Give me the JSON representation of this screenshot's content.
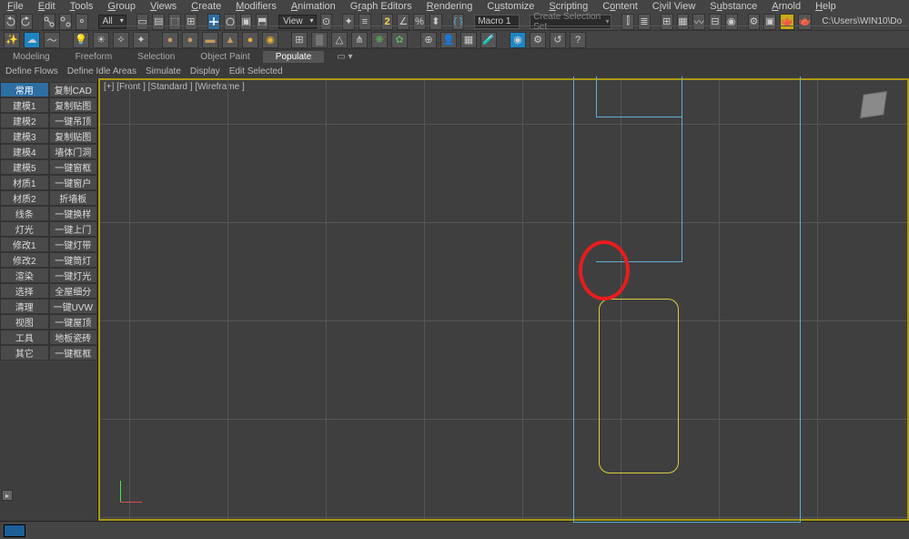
{
  "menu": [
    "File",
    "Edit",
    "Tools",
    "Group",
    "Views",
    "Create",
    "Modifiers",
    "Animation",
    "Graph Editors",
    "Rendering",
    "Customize",
    "Scripting",
    "Content",
    "Civil View",
    "Substance",
    "Arnold",
    "Help"
  ],
  "menu_accel": [
    0,
    0,
    0,
    0,
    0,
    0,
    0,
    0,
    1,
    0,
    1,
    0,
    1,
    1,
    1,
    0,
    0
  ],
  "row1": {
    "dropdown_all": "All",
    "dropdown_view": "View",
    "macro_label": "Macro 1",
    "sel_set_placeholder": "Create Selection Set",
    "path": "C:\\Users\\WIN10\\Do"
  },
  "tabs": [
    "Modeling",
    "Freeform",
    "Selection",
    "Object Paint",
    "Populate"
  ],
  "tabs_active": 4,
  "help_tabs": [
    "Define Flows",
    "Define Idle Areas",
    "Simulate",
    "Display",
    "Edit Selected"
  ],
  "panel": {
    "col1": [
      "常用",
      "建模1",
      "建模2",
      "建模3",
      "建模4",
      "建模5",
      "材质1",
      "材质2",
      "线条",
      "灯光",
      "修改1",
      "修改2",
      "渲染",
      "选择",
      "清理",
      "视图",
      "工具",
      "其它"
    ],
    "col2": [
      "复制CAD",
      "复制贴图",
      "一键吊顶",
      "复制贴图",
      "墙体门洞",
      "一键窗框",
      "一键窗户",
      "折墙板",
      "一键换样",
      "一键上门",
      "一键灯带",
      "一键筒灯",
      "一键灯光",
      "全屋细分",
      "一键UVW",
      "一键屋顶",
      "地板瓷砖",
      "一键框框"
    ]
  },
  "panel_active": [
    0
  ],
  "viewport": {
    "label": "[+] [Front ] [Standard ] [Wireframe ]"
  }
}
